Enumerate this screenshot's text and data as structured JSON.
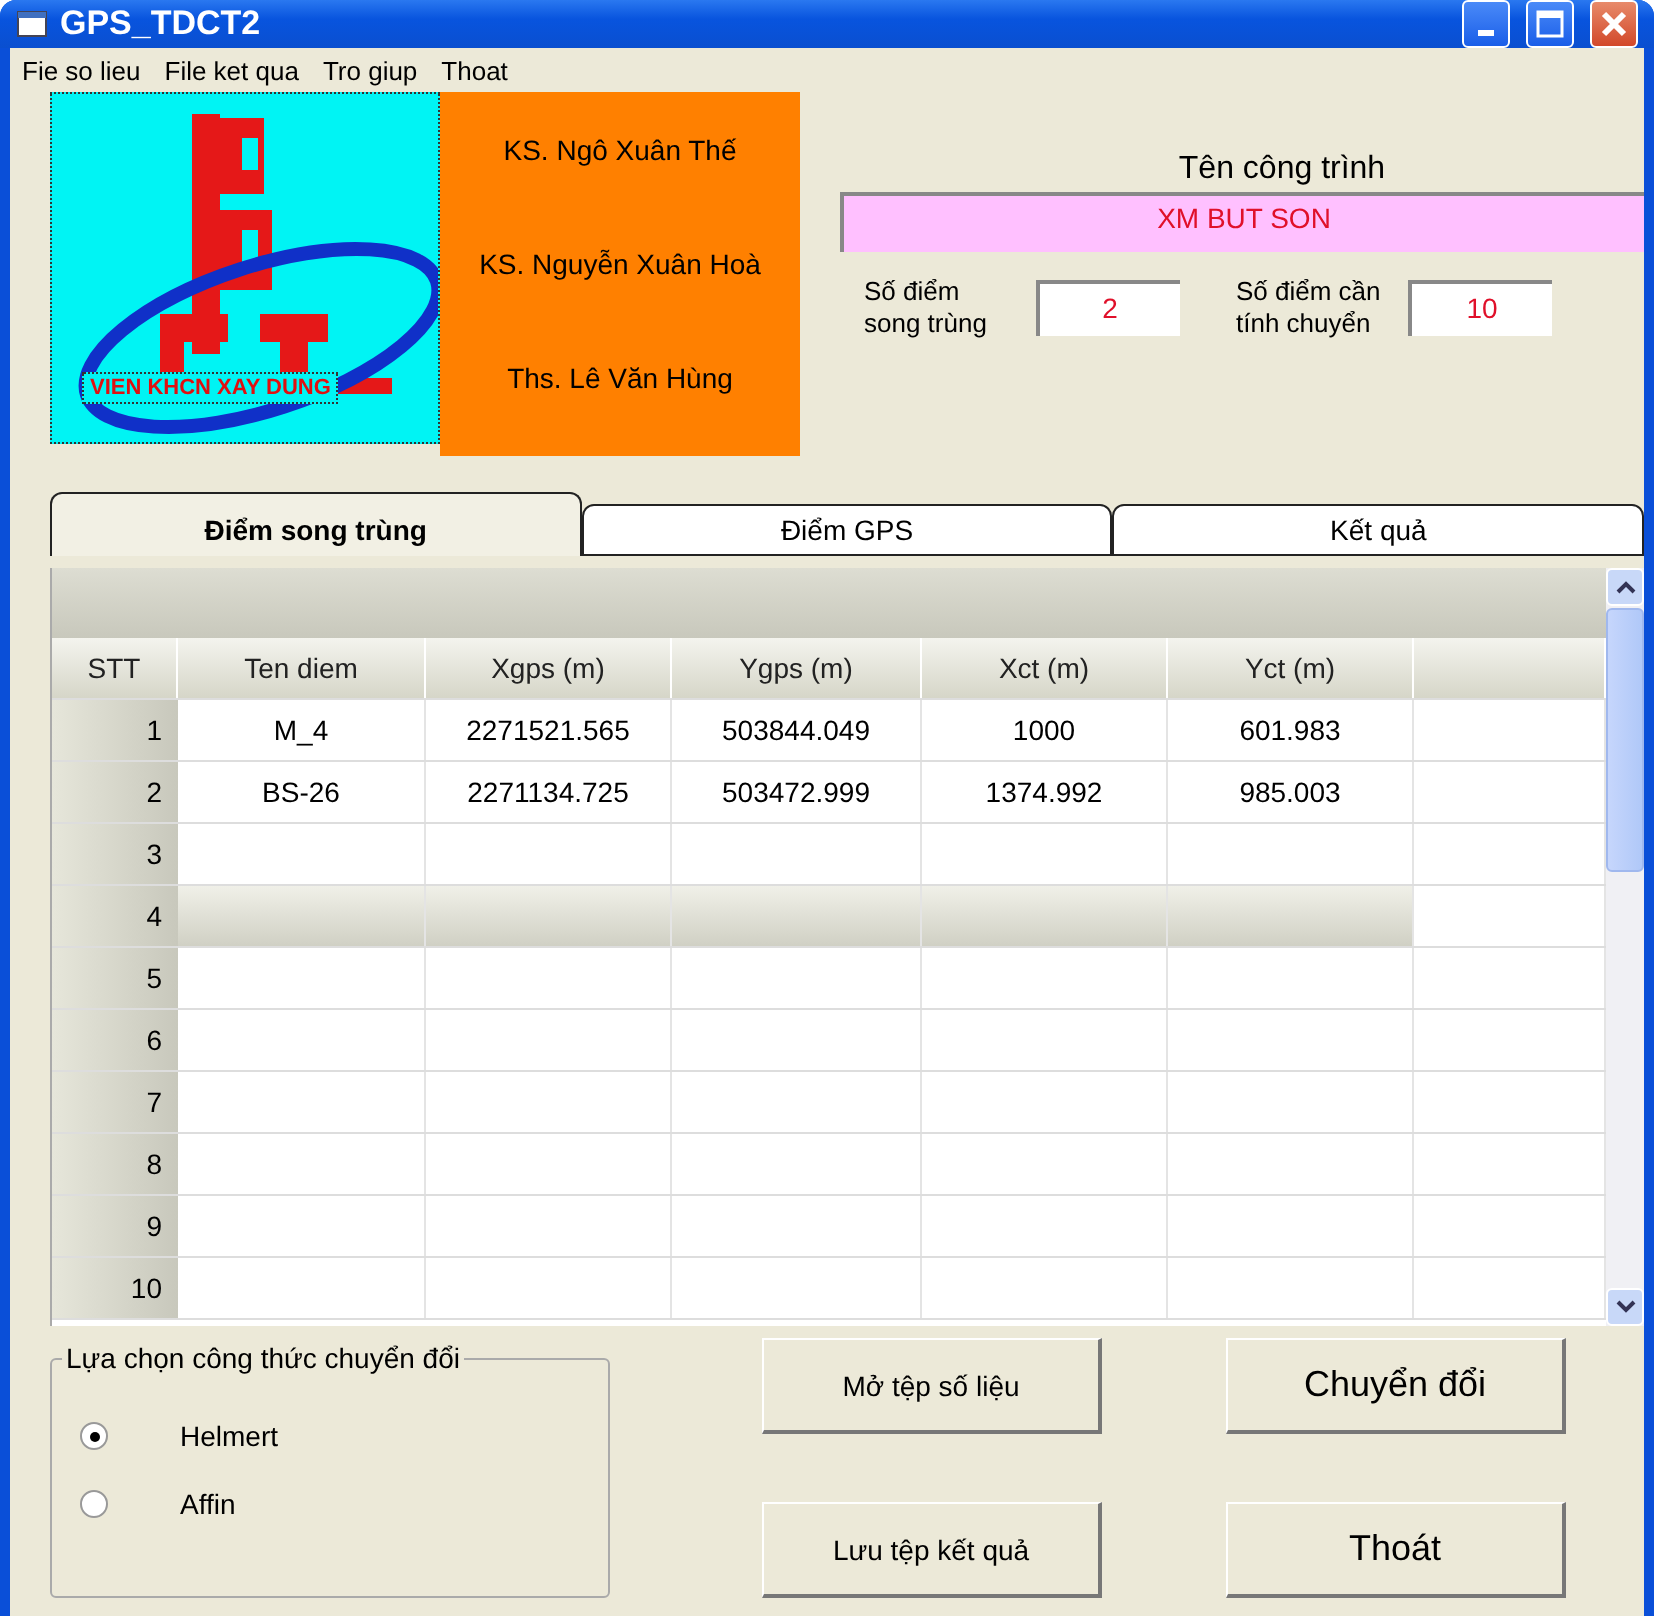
{
  "window": {
    "title": "GPS_TDCT2"
  },
  "menu": [
    "Fie so lieu",
    "File  ket qua",
    "Tro giup",
    "Thoat"
  ],
  "logo": {
    "text": "VIEN KHCN XAY DUNG"
  },
  "authors": [
    "KS. Ngô Xuân Thế",
    "KS. Nguyễn Xuân Hoà",
    "Ths. Lê Văn Hùng"
  ],
  "project": {
    "label": "Tên công trình",
    "value": "XM BUT SON"
  },
  "counts": [
    {
      "label": "Số điểm song trùng",
      "value": "2"
    },
    {
      "label": "Số điểm cần tính chuyển",
      "value": "10"
    }
  ],
  "tabs": [
    {
      "label": "Điểm song trùng",
      "selected": true
    },
    {
      "label": "Điểm GPS",
      "selected": false
    },
    {
      "label": "Kết quả",
      "selected": false
    }
  ],
  "table": {
    "columns": [
      "STT",
      "Ten diem",
      "Xgps (m)",
      "Ygps (m)",
      "Xct (m)",
      "Yct (m)"
    ],
    "rows": [
      {
        "number": "1",
        "cells": [
          "M_4",
          "2271521.565",
          "503844.049",
          "1000",
          "601.983"
        ],
        "selected": false
      },
      {
        "number": "2",
        "cells": [
          "BS-26",
          "2271134.725",
          "503472.999",
          "1374.992",
          "985.003"
        ],
        "selected": false
      },
      {
        "number": "3",
        "selected": false
      },
      {
        "number": "4",
        "selected": true
      },
      {
        "number": "5",
        "selected": false
      },
      {
        "number": "6",
        "selected": false
      },
      {
        "number": "7",
        "selected": false
      },
      {
        "number": "8",
        "selected": false
      },
      {
        "number": "9",
        "selected": false
      },
      {
        "number": "10",
        "selected": false
      }
    ]
  },
  "formula": {
    "title": "Lựa chọn công thức chuyển đổi",
    "options": [
      {
        "label": "Helmert",
        "selected": true
      },
      {
        "label": "Affin",
        "selected": false
      }
    ]
  },
  "buttons": [
    "Mở tệp số liệu",
    "Chuyển đổi",
    "Lưu tệp kết quả",
    "Thoát"
  ]
}
